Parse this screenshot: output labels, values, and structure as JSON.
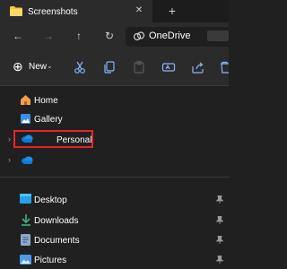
{
  "window": {
    "tab_title": "Screenshots",
    "tab_close_glyph": "✕",
    "new_tab_glyph": "+"
  },
  "navigation": {
    "back_glyph": "←",
    "forward_glyph": "→",
    "up_glyph": "↑",
    "refresh_glyph": "↻",
    "address": "OneDrive"
  },
  "command_bar": {
    "new_label": "New",
    "new_caret": "⌄",
    "new_plus": "⊕",
    "icons": [
      "cut-icon",
      "copy-icon",
      "paste-icon",
      "rename-icon",
      "share-icon",
      "delete-icon"
    ]
  },
  "sidebar": {
    "chevron": "›",
    "items_top": [
      {
        "label": "Home",
        "icon": "home-icon"
      },
      {
        "label": "Gallery",
        "icon": "gallery-icon"
      },
      {
        "label": "Personal",
        "icon": "onedrive-cloud-icon",
        "highlighted": true
      },
      {
        "label": "",
        "icon": "onedrive-cloud-icon"
      }
    ],
    "quick_access": [
      {
        "label": "Desktop",
        "icon": "desktop-folder-icon"
      },
      {
        "label": "Downloads",
        "icon": "downloads-icon"
      },
      {
        "label": "Documents",
        "icon": "documents-icon"
      },
      {
        "label": "Pictures",
        "icon": "pictures-icon"
      }
    ],
    "pin_glyph": "📌"
  },
  "colors": {
    "background": "#202020",
    "toolbar": "#2b2b2b",
    "highlight_box": "#e3242b",
    "onedrive_blue": "#0a7cd8"
  }
}
